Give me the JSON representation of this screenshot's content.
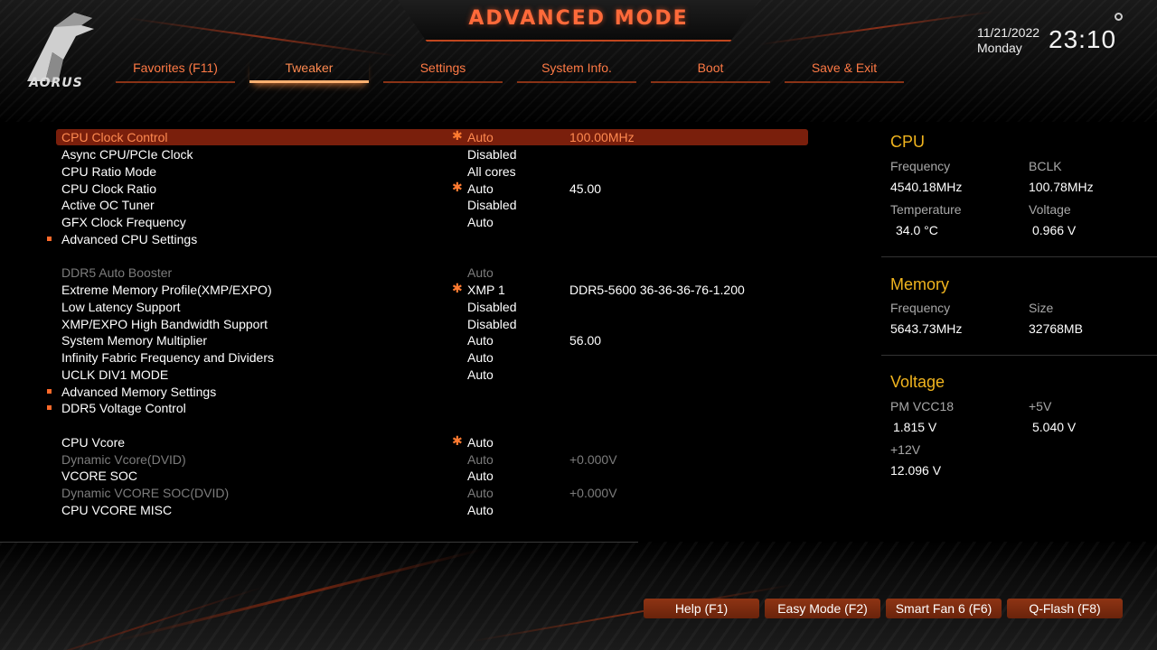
{
  "header": {
    "mode_title": "ADVANCED MODE",
    "logo_text": "AORUS",
    "date": "11/21/2022",
    "weekday": "Monday",
    "time": "23:10"
  },
  "tabs": [
    {
      "label": "Favorites (F11)",
      "active": false
    },
    {
      "label": "Tweaker",
      "active": true
    },
    {
      "label": "Settings",
      "active": false
    },
    {
      "label": "System Info.",
      "active": false
    },
    {
      "label": "Boot",
      "active": false
    },
    {
      "label": "Save & Exit",
      "active": false
    }
  ],
  "settings": [
    {
      "label": "CPU Clock Control",
      "star": true,
      "value": "Auto",
      "value2": "100.00MHz",
      "selected": true
    },
    {
      "label": "Async CPU/PCIe Clock",
      "value": "Disabled"
    },
    {
      "label": "CPU Ratio Mode",
      "value": "All cores"
    },
    {
      "label": "CPU Clock Ratio",
      "star": true,
      "value": "Auto",
      "value2": "45.00"
    },
    {
      "label": "Active OC Tuner",
      "value": "Disabled"
    },
    {
      "label": "GFX Clock Frequency",
      "value": "Auto"
    },
    {
      "label": "Advanced CPU Settings",
      "submenu": true
    },
    {
      "label": "DDR5 Auto Booster",
      "value": "Auto",
      "dim": true
    },
    {
      "label": "Extreme Memory Profile(XMP/EXPO)",
      "star": true,
      "value": "XMP 1",
      "value2": "DDR5-5600 36-36-36-76-1.200"
    },
    {
      "label": "Low Latency Support",
      "value": "Disabled"
    },
    {
      "label": "XMP/EXPO High Bandwidth Support",
      "value": "Disabled"
    },
    {
      "label": "System Memory Multiplier",
      "value": "Auto",
      "value2": "56.00"
    },
    {
      "label": "Infinity Fabric Frequency and Dividers",
      "value": "Auto"
    },
    {
      "label": "UCLK DIV1 MODE",
      "value": "Auto"
    },
    {
      "label": "Advanced Memory Settings",
      "submenu": true
    },
    {
      "label": "DDR5 Voltage Control",
      "submenu": true
    },
    {
      "label": "CPU Vcore",
      "star": true,
      "value": "Auto"
    },
    {
      "label": "Dynamic Vcore(DVID)",
      "value": "Auto",
      "value2": "+0.000V",
      "dim": true
    },
    {
      "label": "VCORE SOC",
      "value": "Auto"
    },
    {
      "label": "Dynamic VCORE SOC(DVID)",
      "value": "Auto",
      "value2": "+0.000V",
      "dim": true
    },
    {
      "label": "CPU VCORE MISC",
      "value": "Auto"
    }
  ],
  "panel": {
    "cpu": {
      "title": "CPU",
      "frequency_label": "Frequency",
      "frequency": "4540.18MHz",
      "bclk_label": "BCLK",
      "bclk": "100.78MHz",
      "temperature_label": "Temperature",
      "temperature": "34.0 °C",
      "voltage_label": "Voltage",
      "voltage": "0.966 V"
    },
    "memory": {
      "title": "Memory",
      "frequency_label": "Frequency",
      "frequency": "5643.73MHz",
      "size_label": "Size",
      "size": "32768MB"
    },
    "voltage": {
      "title": "Voltage",
      "pm_vcc18_label": "PM VCC18",
      "pm_vcc18": "1.815 V",
      "p5v_label": "+5V",
      "p5v": "5.040 V",
      "p12v_label": "+12V",
      "p12v": "12.096 V"
    }
  },
  "footer_buttons": [
    {
      "label": "Help (F1)"
    },
    {
      "label": "Easy Mode (F2)"
    },
    {
      "label": "Smart Fan 6 (F6)"
    },
    {
      "label": "Q-Flash (F8)"
    }
  ],
  "colors": {
    "accent": "#ff7a45",
    "selected_row": "#7a1f0c",
    "panel_title": "#f0b41e",
    "button": "#8e3414"
  }
}
